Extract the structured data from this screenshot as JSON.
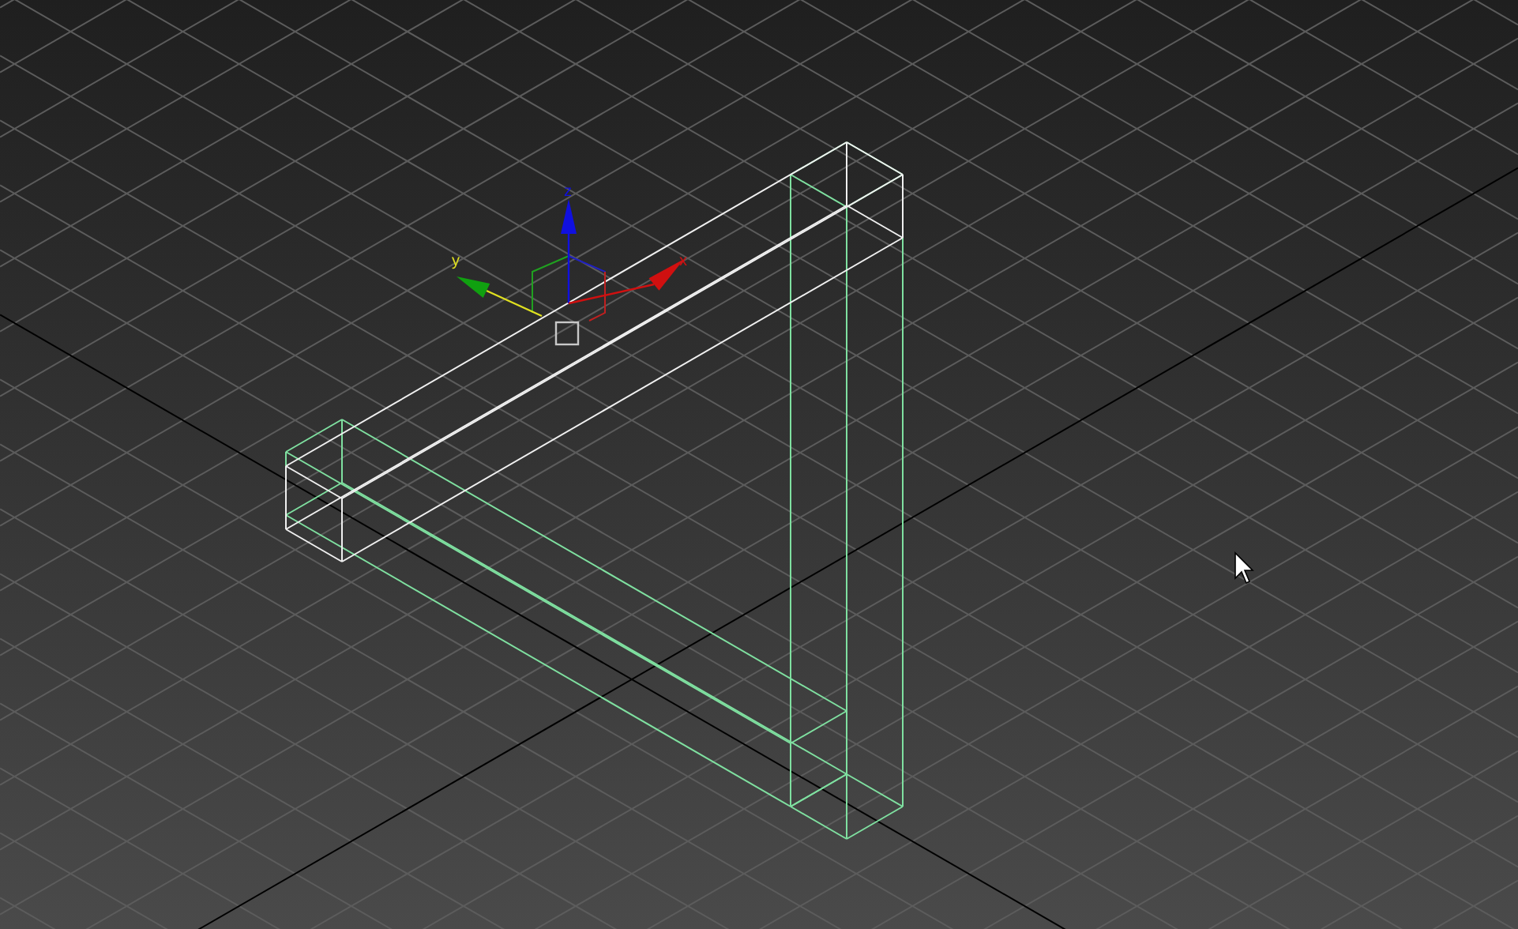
{
  "viewport": {
    "gizmo": {
      "axes": [
        {
          "kind": "z",
          "label": "z",
          "color": "#1010e0"
        },
        {
          "kind": "y",
          "label": "y",
          "color": "#10a010"
        },
        {
          "kind": "x",
          "label": "x",
          "color": "#d01010"
        }
      ]
    }
  }
}
